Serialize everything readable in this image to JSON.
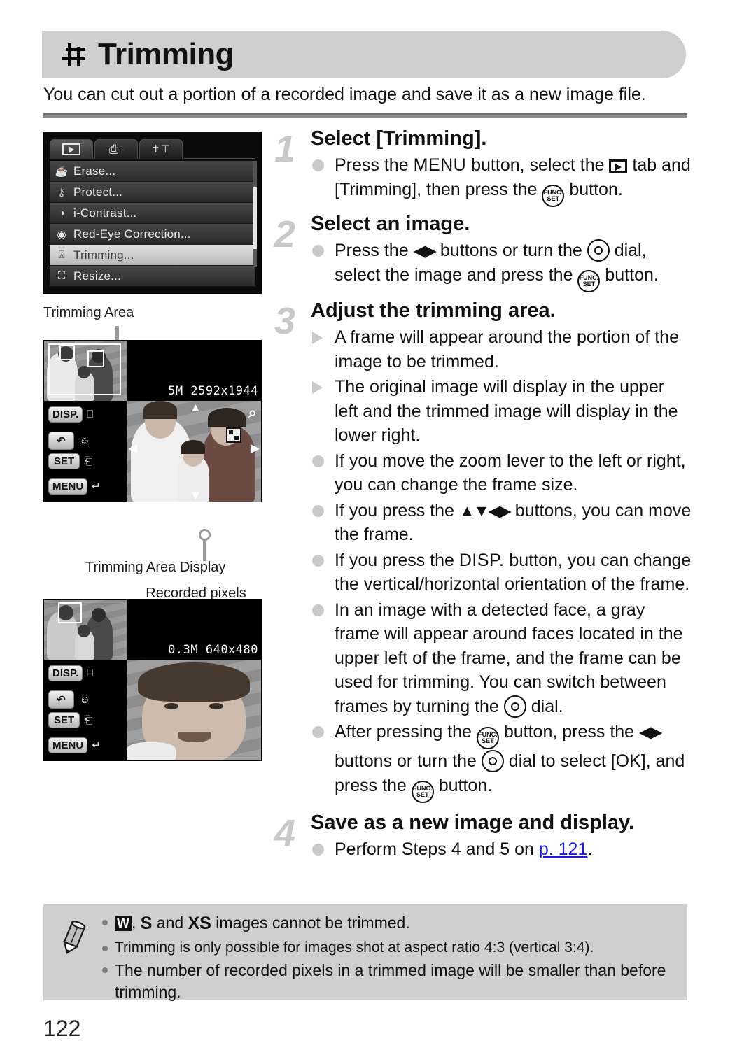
{
  "header": {
    "icon": "crop-icon",
    "title": "Trimming"
  },
  "intro": "You can cut out a portion of a recorded image and save it as a new image file.",
  "camera_menu": {
    "tabs": [
      "playback-tab",
      "print-tab",
      "settings-tab"
    ],
    "active_tab": "playback-tab",
    "items": [
      {
        "icon": "erase-icon",
        "label": "Erase..."
      },
      {
        "icon": "protect-key-icon",
        "label": "Protect..."
      },
      {
        "icon": "i-contrast-icon",
        "label": "i-Contrast..."
      },
      {
        "icon": "red-eye-icon",
        "label": "Red-Eye Correction..."
      },
      {
        "icon": "crop-icon",
        "label": "Trimming..."
      },
      {
        "icon": "resize-icon",
        "label": "Resize..."
      }
    ],
    "selected": "Trimming..."
  },
  "captions": {
    "trimming_area": "Trimming Area",
    "trimming_area_display": "Trimming Area Display",
    "recorded_pixels": "Recorded pixels\nafter trimming"
  },
  "lcd_top": {
    "resolution": "5M  2592x1944",
    "buttons": {
      "disp": "DISP.",
      "set": "SET",
      "menu": "MENU"
    }
  },
  "lcd_bottom": {
    "resolution": "0.3M 640x480",
    "buttons": {
      "disp": "DISP.",
      "set": "SET",
      "menu": "MENU"
    }
  },
  "steps": [
    {
      "num": "1",
      "title": "Select [Trimming].",
      "bullets": [
        {
          "marker": "dot",
          "parts": [
            {
              "t": "text",
              "v": "Press the "
            },
            {
              "t": "glyph",
              "v": "MENU"
            },
            {
              "t": "text",
              "v": " button, select the "
            },
            {
              "t": "glyph",
              "v": "playback-icon"
            },
            {
              "t": "text",
              "v": " tab and [Trimming], then press the "
            },
            {
              "t": "glyph",
              "v": "func-set-icon"
            },
            {
              "t": "text",
              "v": " button."
            }
          ]
        }
      ]
    },
    {
      "num": "2",
      "title": "Select an image.",
      "bullets": [
        {
          "marker": "dot",
          "parts": [
            {
              "t": "text",
              "v": "Press the "
            },
            {
              "t": "glyph",
              "v": "left-right-arrows"
            },
            {
              "t": "text",
              "v": " buttons or turn the "
            },
            {
              "t": "glyph",
              "v": "dial-icon"
            },
            {
              "t": "text",
              "v": " dial, select the image and press the "
            },
            {
              "t": "glyph",
              "v": "func-set-icon"
            },
            {
              "t": "text",
              "v": " button."
            }
          ]
        }
      ]
    },
    {
      "num": "3",
      "title": "Adjust the trimming area.",
      "bullets": [
        {
          "marker": "triangle",
          "parts": [
            {
              "t": "text",
              "v": "A frame will appear around the portion of the image to be trimmed."
            }
          ]
        },
        {
          "marker": "triangle",
          "parts": [
            {
              "t": "text",
              "v": "The original image will display in the upper left and the trimmed image will display in the lower right."
            }
          ]
        },
        {
          "marker": "dot",
          "parts": [
            {
              "t": "text",
              "v": "If you move the zoom lever to the left or right, you can change the frame size."
            }
          ]
        },
        {
          "marker": "dot",
          "parts": [
            {
              "t": "text",
              "v": "If you press the "
            },
            {
              "t": "glyph",
              "v": "up-down-left-right-arrows"
            },
            {
              "t": "text",
              "v": " buttons, you can move the frame."
            }
          ]
        },
        {
          "marker": "dot",
          "parts": [
            {
              "t": "text",
              "v": "If you press the "
            },
            {
              "t": "glyph",
              "v": "DISP."
            },
            {
              "t": "text",
              "v": " button, you can change the vertical/horizontal orientation of the frame."
            }
          ]
        },
        {
          "marker": "dot",
          "parts": [
            {
              "t": "text",
              "v": "In an image with a detected face, a gray frame will appear around faces located in the upper left of the frame, and the frame can be used for trimming. You can switch between frames by turning the "
            },
            {
              "t": "glyph",
              "v": "dial-icon"
            },
            {
              "t": "text",
              "v": " dial."
            }
          ]
        },
        {
          "marker": "dot",
          "parts": [
            {
              "t": "text",
              "v": "After pressing the "
            },
            {
              "t": "glyph",
              "v": "func-set-icon"
            },
            {
              "t": "text",
              "v": " button, press the "
            },
            {
              "t": "glyph",
              "v": "left-right-arrows"
            },
            {
              "t": "text",
              "v": " buttons or turn the "
            },
            {
              "t": "glyph",
              "v": "dial-icon"
            },
            {
              "t": "text",
              "v": " dial to select [OK], and press the "
            },
            {
              "t": "glyph",
              "v": "func-set-icon"
            },
            {
              "t": "text",
              "v": " button."
            }
          ]
        }
      ]
    },
    {
      "num": "4",
      "title": "Save as a new image and display.",
      "bullets": [
        {
          "marker": "dot",
          "parts": [
            {
              "t": "text",
              "v": "Perform Steps 4 and 5 on "
            },
            {
              "t": "link",
              "v": "p. 121"
            },
            {
              "t": "text",
              "v": "."
            }
          ]
        }
      ]
    }
  ],
  "step_titles": {
    "s1": "Select [Trimming].",
    "s2": "Select an image.",
    "s3": "Adjust the trimming area.",
    "s4": "Save as a new image and display."
  },
  "step_nums": {
    "n1": "1",
    "n2": "2",
    "n3": "3",
    "n4": "4"
  },
  "step1_b1_a": "Press the ",
  "step1_b1_menu": "MENU",
  "step1_b1_b": " button, select the ",
  "step1_b1_c": " tab and [Trimming], then press the ",
  "step1_b1_d": " button.",
  "step2_b1_a": "Press the ",
  "step2_b1_b": " buttons or turn the ",
  "step2_b1_c": " dial, select the image and press the ",
  "step2_b1_d": " button.",
  "step3_b1": "A frame will appear around the portion of the image to be trimmed.",
  "step3_b2": "The original image will display in the upper left and the trimmed image will display in the lower right.",
  "step3_b3": "If you move the zoom lever to the left or right, you can change the frame size.",
  "step3_b4_a": "If you press the ",
  "step3_b4_b": " buttons, you can move the frame.",
  "step3_b5_a": "If you press the ",
  "step3_b5_disp": "DISP.",
  "step3_b5_b": " button, you can change the vertical/horizontal orientation of the frame.",
  "step3_b6_a": "In an image with a detected face, a gray frame will appear around faces located in the upper left of the frame, and the frame can be used for trimming. You can switch between frames by turning the ",
  "step3_b6_b": " dial.",
  "step3_b7_a": "After pressing the ",
  "step3_b7_b": " button, press the ",
  "step3_b7_c": " buttons or turn the ",
  "step3_b7_d": " dial to select [OK], and press the ",
  "step3_b7_e": " button.",
  "step4_b1_a": "Perform Steps 4 and 5 on ",
  "step4_b1_link": "p. 121",
  "step4_b1_b": ".",
  "note": {
    "icon": "pencil-icon",
    "items": [
      {
        "chip_w": "W",
        "chip_s": "S",
        "chip_xs": "XS",
        "text_a": ", ",
        "text_b": " and ",
        "text_c": " images cannot be trimmed."
      },
      {
        "text": "Trimming is only possible for images shot at aspect ratio 4:3 (vertical 3:4)."
      },
      {
        "text": "The number of recorded pixels in a trimmed image will be smaller than before trimming."
      }
    ]
  },
  "note_i1_a": ", ",
  "note_i1_b": " and ",
  "note_i1_c": " images cannot be trimmed.",
  "note_i1_w": "W",
  "note_i1_s": "S",
  "note_i1_xs": "XS",
  "note_i2": "Trimming is only possible for images shot at aspect ratio 4:3 (vertical 3:4).",
  "note_i3": "The number of recorded pixels in a trimmed image will be smaller than before trimming.",
  "page_number": "122",
  "colors": {
    "header_bg": "#cfcfcf",
    "note_bg": "#cfcfcf",
    "link": "#1a1ae6",
    "step_num": "#c9c9c9"
  }
}
